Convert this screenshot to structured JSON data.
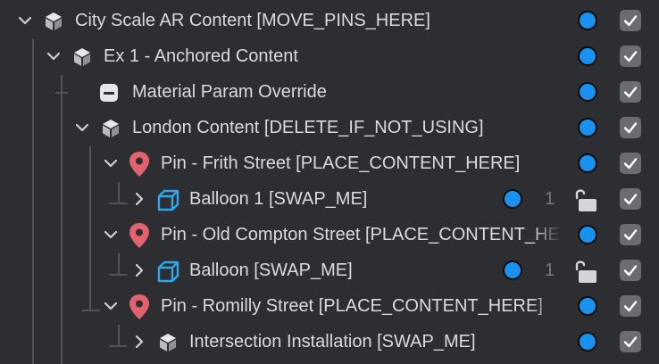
{
  "colors": {
    "background": "#2d2e31",
    "text": "#dadbde",
    "visibility_dot": "#1a91ef",
    "pin": "#e2626d",
    "mesh": "#2fa6f0",
    "checkbox": "#6a6c72"
  },
  "tree": {
    "rows": [
      {
        "label": "City Scale AR Content [MOVE_PINS_HERE]",
        "icon": "group-icon",
        "expanded": true,
        "checked": true
      },
      {
        "label": "Ex 1 - Anchored Content",
        "icon": "group-icon",
        "expanded": true,
        "checked": true
      },
      {
        "label": "Material Param Override",
        "icon": "material-override-icon",
        "checked": true
      },
      {
        "label": "London Content [DELETE_IF_NOT_USING]",
        "icon": "group-icon",
        "expanded": true,
        "checked": true
      },
      {
        "label": "Pin - Frith Street [PLACE_CONTENT_HERE]",
        "icon": "map-pin-icon",
        "expanded": true,
        "checked": true
      },
      {
        "label": "Balloon 1 [SWAP_ME]",
        "icon": "mesh-cube-icon",
        "expanded": false,
        "count": "1",
        "locked": true,
        "checked": true
      },
      {
        "label": "Pin - Old Compton Street [PLACE_CONTENT_HERE]",
        "icon": "map-pin-icon",
        "expanded": true,
        "checked": true
      },
      {
        "label": "Balloon [SWAP_ME]",
        "icon": "mesh-cube-icon",
        "expanded": false,
        "count": "1",
        "locked": true,
        "checked": true
      },
      {
        "label": "Pin - Romilly Street [PLACE_CONTENT_HERE]",
        "icon": "map-pin-icon",
        "expanded": true,
        "checked": true
      },
      {
        "label": "Intersection Installation [SWAP_ME]",
        "icon": "group-icon",
        "expanded": false,
        "checked": true
      }
    ]
  }
}
